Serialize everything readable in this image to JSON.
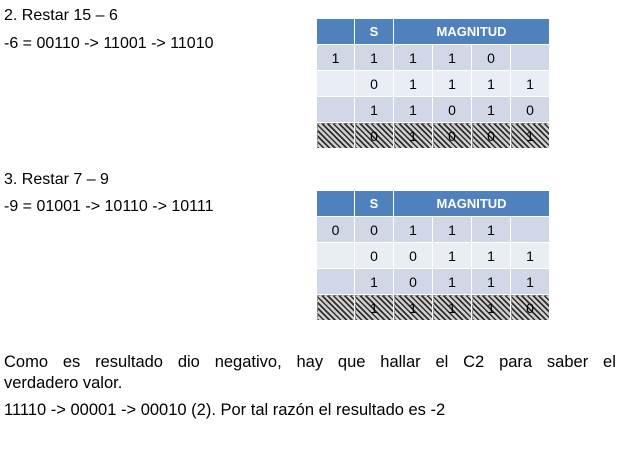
{
  "section1": {
    "title": "2. Restar  15 – 6",
    "conversion": " -6 = 00110 -> 11001 -> 11010",
    "table": {
      "header": [
        "",
        "S",
        "MAGNITUD"
      ],
      "rows": [
        [
          "1",
          "1",
          "1",
          "1",
          "0",
          ""
        ],
        [
          "",
          "0",
          "1",
          "1",
          "1",
          "1"
        ],
        [
          "",
          "1",
          "1",
          "0",
          "1",
          "0"
        ],
        [
          "",
          "0",
          "1",
          "0",
          "0",
          "1"
        ]
      ]
    }
  },
  "section2": {
    "title": "3. Restar  7 – 9",
    "conversion": " -9 = 01001 -> 10110 -> 10111",
    "table": {
      "header": [
        "",
        "S",
        "MAGNITUD"
      ],
      "rows": [
        [
          "0",
          "0",
          "1",
          "1",
          "1",
          ""
        ],
        [
          "",
          "0",
          "0",
          "1",
          "1",
          "1"
        ],
        [
          "",
          "1",
          "0",
          "1",
          "1",
          "1"
        ],
        [
          "",
          "1",
          "1",
          "1",
          "1",
          "0"
        ]
      ]
    }
  },
  "conclusion": {
    "line1_words": [
      "Como",
      "es",
      "resultado",
      "dio",
      "negativo,",
      "hay",
      "que",
      "hallar",
      "el",
      "C2",
      "para",
      "saber",
      "el"
    ],
    "line2": "verdadero valor.",
    "line3": "11110 -> 00001 -> 00010 (2). Por tal razón el resultado es -2"
  }
}
